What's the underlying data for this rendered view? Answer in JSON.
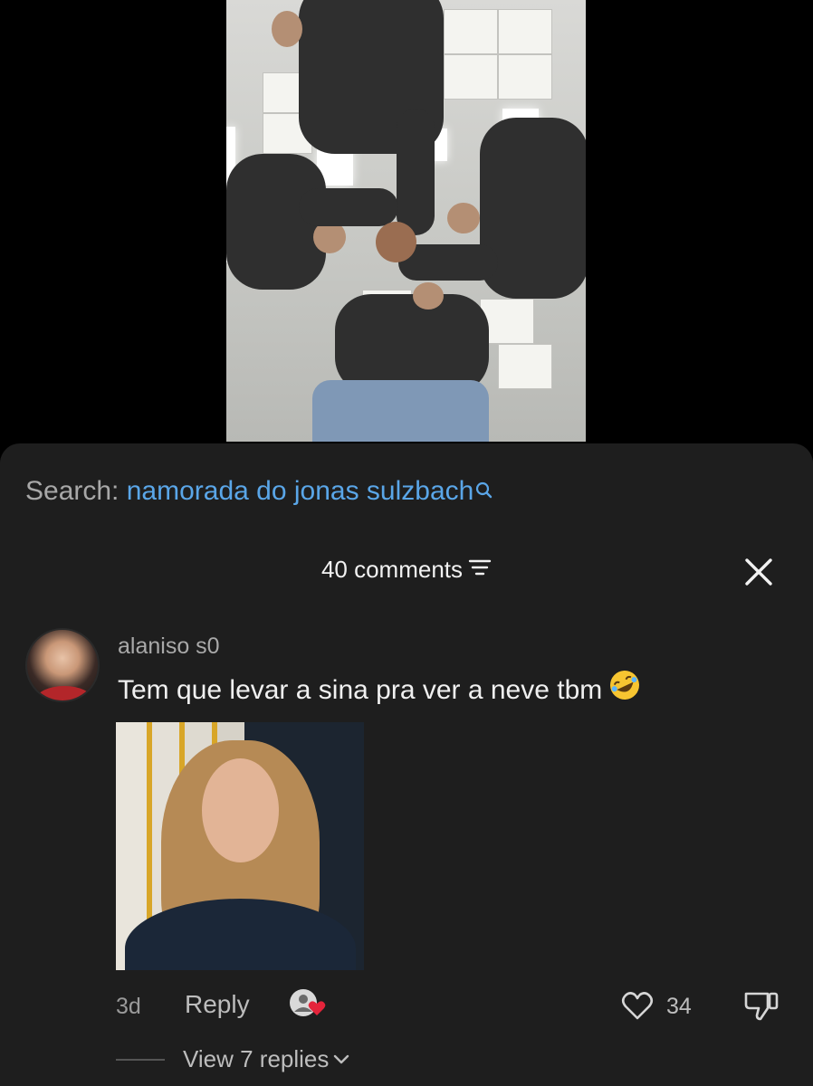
{
  "search": {
    "label": "Search:",
    "query": "namorada do jonas sulzbach"
  },
  "comments_header": {
    "count_label": "40 comments"
  },
  "comment": {
    "username": "alaniso s0",
    "text": "Tem que levar a sina pra ver a neve tbm",
    "emoji": "rolling-on-the-floor-laughing",
    "time": "3d",
    "reply_label": "Reply",
    "like_count": "34",
    "view_replies_label": "View 7 replies"
  },
  "colors": {
    "sheet_bg": "#1e1e1e",
    "search_query": "#5aa6e8",
    "like_heart_badge": "#e5243b"
  },
  "icons": {
    "search": "search-icon",
    "sort": "sort-icon",
    "close": "close-icon",
    "like": "heart-outline-icon",
    "dislike": "thumbs-down-icon",
    "chevron": "chevron-down-icon"
  }
}
